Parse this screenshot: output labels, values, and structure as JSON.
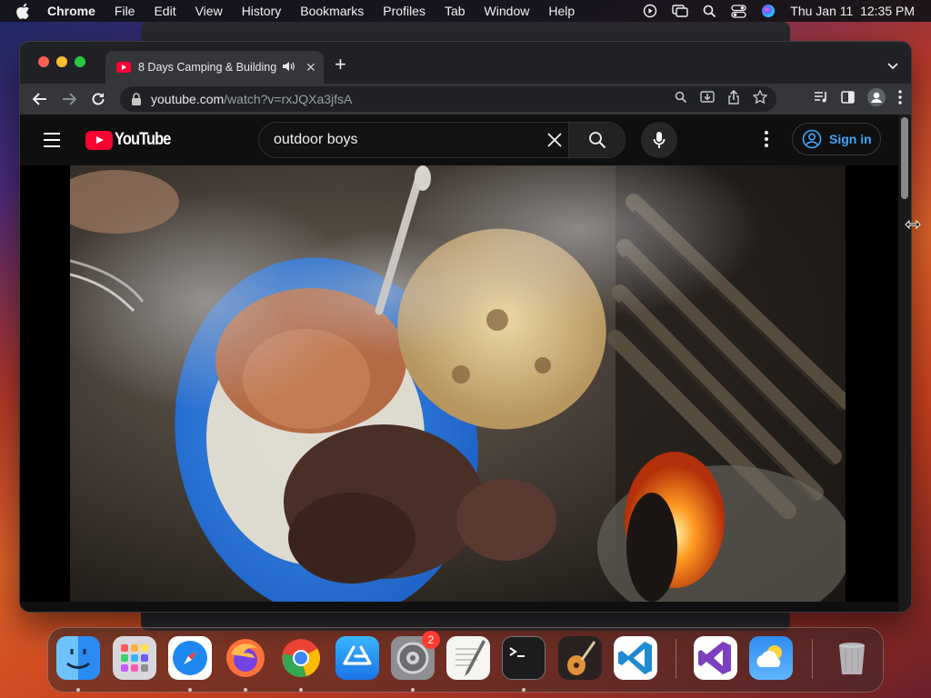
{
  "menubar": {
    "app_name": "Chrome",
    "items": [
      "File",
      "Edit",
      "View",
      "History",
      "Bookmarks",
      "Profiles",
      "Tab",
      "Window",
      "Help"
    ],
    "clock": "Thu Jan 11  12:35 PM",
    "status_icons": [
      "play-circle-icon",
      "screen-mirror-icon",
      "spotlight-search-icon",
      "control-center-icon",
      "siri-icon"
    ]
  },
  "browser": {
    "tab_title": "8 Days Camping & Building",
    "new_tab_symbol": "+",
    "url_host": "youtube.com",
    "url_path": "/watch?v=rxJQXa3jfsA"
  },
  "youtube": {
    "logo_text": "YouTube",
    "search_query": "outdoor boys",
    "sign_in_label": "Sign in",
    "video_description": "Close-up of a blue plate with rice, stew, grilled meat and flatbread beside a campfire"
  },
  "dock": {
    "apps": [
      "finder",
      "launchpad",
      "safari",
      "firefox",
      "chrome",
      "app-store",
      "system-settings",
      "textedit",
      "terminal",
      "garageband",
      "vscode",
      "visual-studio",
      "weather",
      "trash"
    ],
    "settings_badge": "2"
  },
  "colors": {
    "youtube_red": "#ff0033",
    "link_blue": "#3ea6ff",
    "chrome_dark": "#202124"
  }
}
